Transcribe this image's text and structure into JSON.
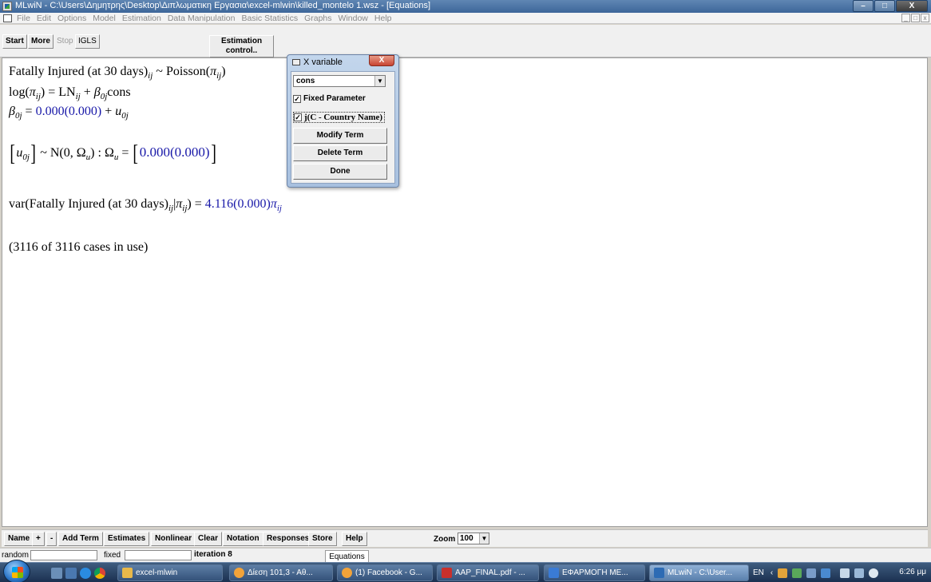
{
  "window": {
    "title": "MLwiN - C:\\Users\\Δημητρης\\Desktop\\Διπλωματικη Εργασια\\excel-mlwin\\killed_montelo 1.wsz - [Equations]",
    "controls": [
      "–",
      "□",
      "X"
    ]
  },
  "menu": [
    "File",
    "Edit",
    "Options",
    "Model",
    "Estimation",
    "Data Manipulation",
    "Basic Statistics",
    "Graphs",
    "Window",
    "Help"
  ],
  "mdi_controls": [
    "_",
    "□",
    "x"
  ],
  "toolbar": {
    "start": "Start",
    "more": "More",
    "stop": "Stop",
    "method": "IGLS",
    "estimation_control_line1": "Estimation",
    "estimation_control_line2": "control.."
  },
  "equations": {
    "response": "Fatally Injured (at 30 days)",
    "line1_dist": "~ Poisson(",
    "pi": "π",
    "ij": "ij",
    "line2_log": "log(",
    "line2_mid": ") = LN",
    "line2_plus": " + ",
    "beta": "β",
    "beta_sub": "0j",
    "line2_cons": "cons",
    "beta0_value": "0.000(0.000)",
    "u": "u",
    "u_sub": "0j",
    "line4_dist": "~ N(0,  Ω",
    "omega_sub": "u",
    "omega_sym": "Ω",
    "omega_value": "0.000(0.000)",
    "var_prefix": "var(Fatally Injured (at 30 days)",
    "var_value": "4.116(0.000)",
    "cases": "(3116 of 3116 cases in use)"
  },
  "xvariable_dialog": {
    "title": "X variable",
    "close": "X",
    "selected_variable": "cons",
    "fixed_parameter": "Fixed Parameter",
    "fixed_parameter_checked": true,
    "level_label": "j(C - Country Name)",
    "level_checked": true,
    "modify_term": "Modify Term",
    "delete_term": "Delete Term",
    "done": "Done"
  },
  "bottom_toolbar": {
    "name": "Name",
    "plus": "+",
    "minus": "-",
    "add_term": "Add Term",
    "estimates": "Estimates",
    "nonlinear": "Nonlinear",
    "clear": "Clear",
    "notation": "Notation",
    "responses": "Responses",
    "store": "Store",
    "help": "Help",
    "zoom_label": "Zoom",
    "zoom_value": "100"
  },
  "statusbar": {
    "random_label": "random",
    "fixed_label": "fixed",
    "iteration": "iteration 8",
    "tab": "Equations"
  },
  "taskbar": {
    "tasks": [
      {
        "label": "excel-mlwin",
        "color": "#e8b84a"
      },
      {
        "label": "Δίεση 101,3 - Αθ...",
        "color": "#f2a33a"
      },
      {
        "label": "(1) Facebook - G...",
        "color": "#f2a33a"
      },
      {
        "label": "AAP_FINAL.pdf - ...",
        "color": "#c9302c"
      },
      {
        "label": "ΕΦΑΡΜΟΓΗ ΜΕ...",
        "color": "#3a7bd5"
      },
      {
        "label": "MLwiN - C:\\User...",
        "color": "#2d6bb4"
      }
    ],
    "language": "EN",
    "clock": "6:26 μμ"
  }
}
